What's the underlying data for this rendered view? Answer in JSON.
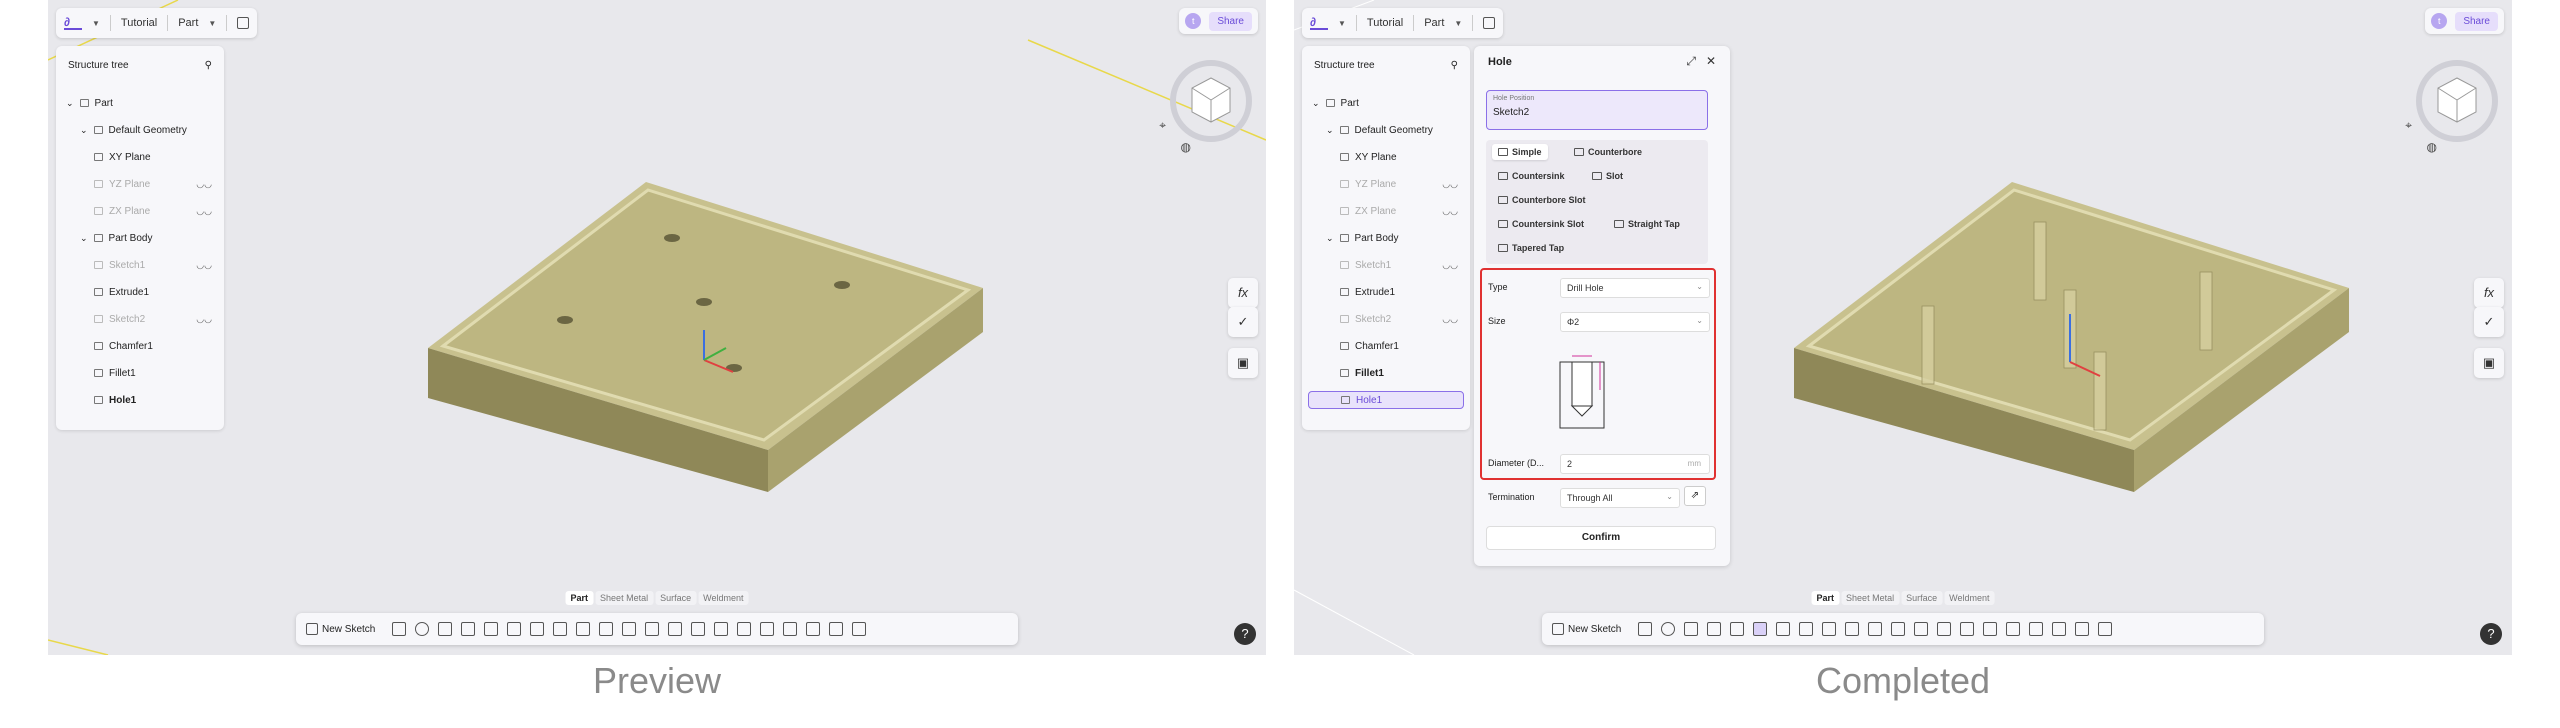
{
  "panels": [
    {
      "caption": "Preview",
      "topbar": {
        "doc": "Tutorial",
        "mode": "Part"
      },
      "share": {
        "avatar_initial": "t",
        "share_label": "Share"
      },
      "tree": {
        "title": "Structure tree",
        "items": [
          {
            "label": "Part",
            "level": 0,
            "dim": false,
            "eye": false,
            "bold": false,
            "selected": false
          },
          {
            "label": "Default Geometry",
            "level": 1,
            "dim": false,
            "eye": false,
            "bold": false,
            "selected": false
          },
          {
            "label": "XY Plane",
            "level": 2,
            "dim": false,
            "eye": false,
            "bold": false,
            "selected": false
          },
          {
            "label": "YZ Plane",
            "level": 2,
            "dim": true,
            "eye": true,
            "bold": false,
            "selected": false
          },
          {
            "label": "ZX Plane",
            "level": 2,
            "dim": true,
            "eye": true,
            "bold": false,
            "selected": false
          },
          {
            "label": "Part Body",
            "level": 1,
            "dim": false,
            "eye": false,
            "bold": false,
            "selected": false
          },
          {
            "label": "Sketch1",
            "level": 2,
            "dim": true,
            "eye": true,
            "bold": false,
            "selected": false
          },
          {
            "label": "Extrude1",
            "level": 2,
            "dim": false,
            "eye": false,
            "bold": false,
            "selected": false
          },
          {
            "label": "Sketch2",
            "level": 2,
            "dim": true,
            "eye": true,
            "bold": false,
            "selected": false
          },
          {
            "label": "Chamfer1",
            "level": 2,
            "dim": false,
            "eye": false,
            "bold": false,
            "selected": false
          },
          {
            "label": "Fillet1",
            "level": 2,
            "dim": false,
            "eye": false,
            "bold": false,
            "selected": false
          },
          {
            "label": "Hole1",
            "level": 2,
            "dim": false,
            "eye": false,
            "bold": true,
            "selected": false
          }
        ]
      },
      "tabs": [
        "Part",
        "Sheet Metal",
        "Surface",
        "Weldment"
      ],
      "toolbar": {
        "new_sketch": "New Sketch"
      },
      "side_icons": [
        "fx",
        "✓",
        "▣"
      ],
      "help": "?"
    },
    {
      "caption": "Completed",
      "topbar": {
        "doc": "Tutorial",
        "mode": "Part"
      },
      "share": {
        "avatar_initial": "t",
        "share_label": "Share"
      },
      "tree": {
        "title": "Structure tree",
        "items": [
          {
            "label": "Part",
            "level": 0,
            "dim": false,
            "eye": false,
            "bold": false,
            "selected": false
          },
          {
            "label": "Default Geometry",
            "level": 1,
            "dim": false,
            "eye": false,
            "bold": false,
            "selected": false
          },
          {
            "label": "XY Plane",
            "level": 2,
            "dim": false,
            "eye": false,
            "bold": false,
            "selected": false
          },
          {
            "label": "YZ Plane",
            "level": 2,
            "dim": true,
            "eye": true,
            "bold": false,
            "selected": false
          },
          {
            "label": "ZX Plane",
            "level": 2,
            "dim": true,
            "eye": true,
            "bold": false,
            "selected": false
          },
          {
            "label": "Part Body",
            "level": 1,
            "dim": false,
            "eye": false,
            "bold": false,
            "selected": false
          },
          {
            "label": "Sketch1",
            "level": 2,
            "dim": true,
            "eye": true,
            "bold": false,
            "selected": false
          },
          {
            "label": "Extrude1",
            "level": 2,
            "dim": false,
            "eye": false,
            "bold": false,
            "selected": false
          },
          {
            "label": "Sketch2",
            "level": 2,
            "dim": true,
            "eye": true,
            "bold": false,
            "selected": false
          },
          {
            "label": "Chamfer1",
            "level": 2,
            "dim": false,
            "eye": false,
            "bold": false,
            "selected": false
          },
          {
            "label": "Fillet1",
            "level": 2,
            "dim": false,
            "eye": false,
            "bold": true,
            "selected": false
          },
          {
            "label": "Hole1",
            "level": 2,
            "dim": false,
            "eye": false,
            "bold": false,
            "selected": true
          }
        ]
      },
      "tabs": [
        "Part",
        "Sheet Metal",
        "Surface",
        "Weldment"
      ],
      "toolbar": {
        "new_sketch": "New Sketch"
      },
      "side_icons": [
        "fx",
        "✓",
        "▣"
      ],
      "help": "?"
    }
  ],
  "hole_dialog": {
    "title": "Hole",
    "position_label": "Hole Position",
    "position_value": "Sketch2",
    "types": [
      "Simple",
      "Counterbore",
      "Countersink",
      "Slot",
      "Counterbore Slot",
      "Countersink Slot",
      "Straight Tap",
      "Tapered Tap"
    ],
    "active_type": "Simple",
    "type_label": "Type",
    "type_value": "Drill Hole",
    "size_label": "Size",
    "size_value": "Φ2",
    "diameter_label": "Diameter (D...",
    "diameter_value": "2",
    "diameter_unit": "mm",
    "termination_label": "Termination",
    "termination_value": "Through All",
    "confirm_label": "Confirm"
  },
  "colors": {
    "accent": "#6a4bd8",
    "highlight_box": "#e03131",
    "plate_top": "#c8c18e",
    "plate_side": "#8f8858"
  }
}
